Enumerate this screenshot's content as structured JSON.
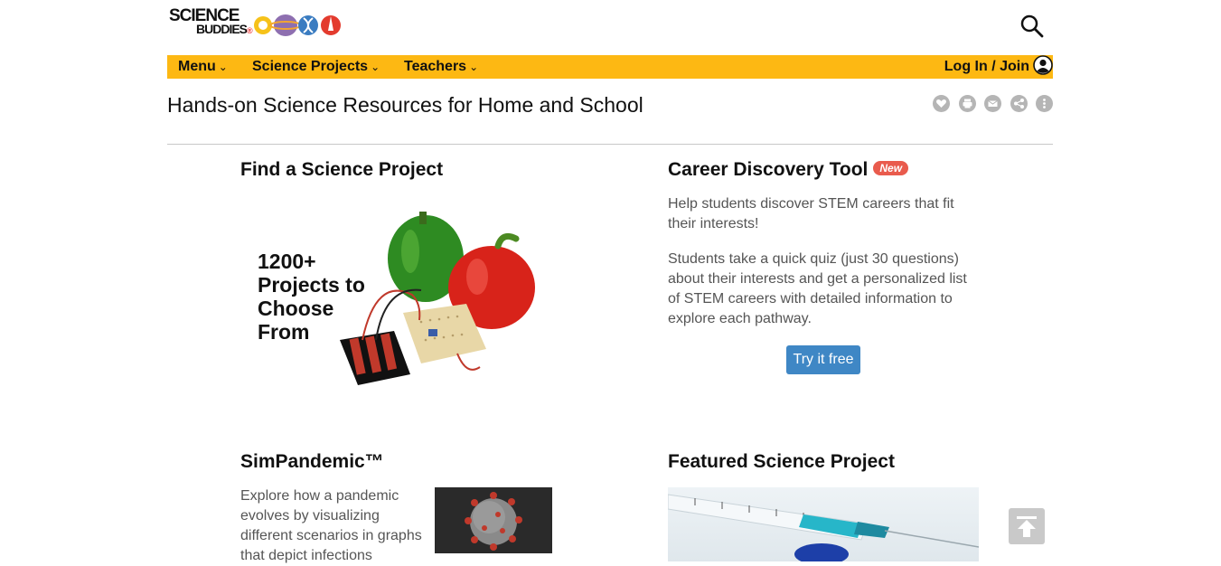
{
  "header": {
    "logo_line1": "SCIENCE",
    "logo_line2": "BUDDIES",
    "logo_mark": "®",
    "search_icon": "search-icon"
  },
  "nav": {
    "items": [
      {
        "label": "Menu"
      },
      {
        "label": "Science Projects"
      },
      {
        "label": "Teachers"
      }
    ],
    "login_label": "Log In / Join",
    "bar_color": "#fdb813"
  },
  "page": {
    "title": "Hands-on Science Resources for Home and School",
    "tools": [
      "heart-icon",
      "print-icon",
      "email-icon",
      "share-icon",
      "more-icon"
    ]
  },
  "find_project": {
    "heading": "Find a Science Project",
    "image_caption": [
      "1200+",
      "Projects to",
      "Choose",
      "From"
    ]
  },
  "career": {
    "heading": "Career Discovery Tool",
    "badge": "New",
    "para1": "Help students discover STEM careers that fit their interests!",
    "para2": "Students take a quick quiz (just 30 questions) about their interests and get a personalized list of STEM careers with detailed information to explore each pathway.",
    "button": "Try it free",
    "button_color": "#3f87c5"
  },
  "simpandemic": {
    "heading": "SimPandemic™",
    "text": "Explore how a pandemic evolves by visualizing different scenarios in graphs that depict infections"
  },
  "featured": {
    "heading": "Featured Science Project"
  }
}
